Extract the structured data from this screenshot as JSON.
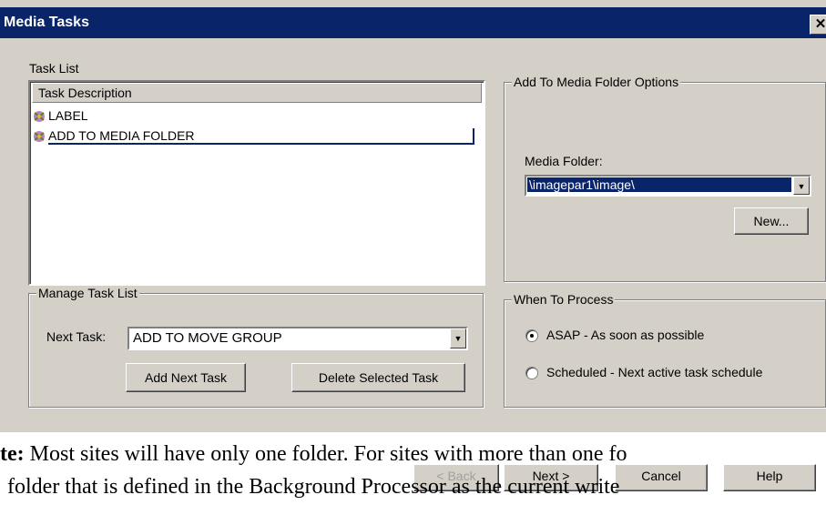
{
  "window": {
    "title": "Media Tasks",
    "close_glyph": "✕"
  },
  "task_list": {
    "group_label": "Task List",
    "column_header": "Task Description",
    "items": [
      {
        "label": "LABEL",
        "icon": "task-icon",
        "selected": false
      },
      {
        "label": "ADD TO MEDIA FOLDER",
        "icon": "task-icon",
        "selected": true
      }
    ]
  },
  "media_folder_options": {
    "group_label": "Add To Media Folder Options",
    "field_label": "Media Folder:",
    "value": "\\imagepar1\\image\\",
    "new_button": "New..."
  },
  "manage": {
    "group_label": "Manage Task List",
    "next_task_label": "Next Task:",
    "next_task_value": "ADD TO MOVE GROUP",
    "add_button": "Add Next Task",
    "delete_button": "Delete Selected Task"
  },
  "when": {
    "group_label": "When To Process",
    "options": [
      {
        "label": "ASAP - As soon as possible",
        "checked": true
      },
      {
        "label": "Scheduled - Next active task schedule",
        "checked": false
      }
    ]
  },
  "footer_buttons": {
    "back": "< Back",
    "next": "Next >",
    "cancel": "Cancel",
    "help": "Help"
  },
  "document": {
    "line1_bold": "te:",
    "line1_rest": " Most sites will have only one folder. For sites with more than one fo",
    "line2": "folder that is defined in the Background Processor as the current write"
  },
  "colors": {
    "titlebar": "#0a246a",
    "selection": "#0a246a",
    "face": "#d4d0c8"
  }
}
